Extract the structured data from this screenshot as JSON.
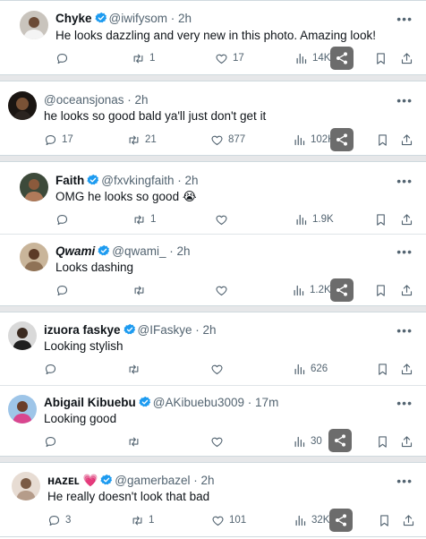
{
  "tweets": [
    {
      "name": "Chyke",
      "handle": "@iwifysom",
      "time": "2h",
      "text": "He looks dazzling and very new in this photo. Amazing look!",
      "verified": true,
      "replies": "",
      "retweets": "1",
      "likes": "17",
      "views": "14K"
    },
    {
      "name": "",
      "handle": "@oceansjonas",
      "time": "2h",
      "text": "he looks so good bald ya'll just don't get it",
      "verified": false,
      "replies": "17",
      "retweets": "21",
      "likes": "877",
      "views": "102K"
    },
    {
      "name": "Faith",
      "handle": "@fxvkingfaith",
      "time": "2h",
      "text": "OMG he looks so good 😭",
      "verified": true,
      "replies": "",
      "retweets": "1",
      "likes": "",
      "views": "1.9K"
    },
    {
      "name": "Qwami",
      "handle": "@qwami_",
      "time": "2h",
      "text": "Looks dashing",
      "verified": true,
      "replies": "",
      "retweets": "",
      "likes": "",
      "views": "1.2K"
    },
    {
      "name": "izuora faskye",
      "handle": "@IFaskye",
      "time": "2h",
      "text": "Looking stylish",
      "verified": true,
      "replies": "",
      "retweets": "",
      "likes": "",
      "views": "626"
    },
    {
      "name": "Abigail Kibuebu",
      "handle": "@AKibuebu3009",
      "time": "17m",
      "text": "Looking good",
      "verified": true,
      "replies": "",
      "retweets": "",
      "likes": "",
      "views": "30"
    },
    {
      "name": "ʜᴀᴢᴇʟ 💗",
      "handle": "@gamerbazel",
      "time": "2h",
      "text": "He really doesn't look that bad",
      "verified": true,
      "replies": "3",
      "retweets": "1",
      "likes": "101",
      "views": "32K"
    }
  ],
  "ui": {
    "more_label": "•••",
    "separator": " · "
  },
  "colors": {
    "verified": "#1d9bf0",
    "muted": "#536471",
    "text": "#0f1419",
    "share_overlay": "#6c6c6c"
  },
  "icons": [
    "reply-icon",
    "retweet-icon",
    "like-icon",
    "views-icon",
    "bookmark-icon",
    "share-icon",
    "share-overlay-icon",
    "verified-badge-icon"
  ]
}
